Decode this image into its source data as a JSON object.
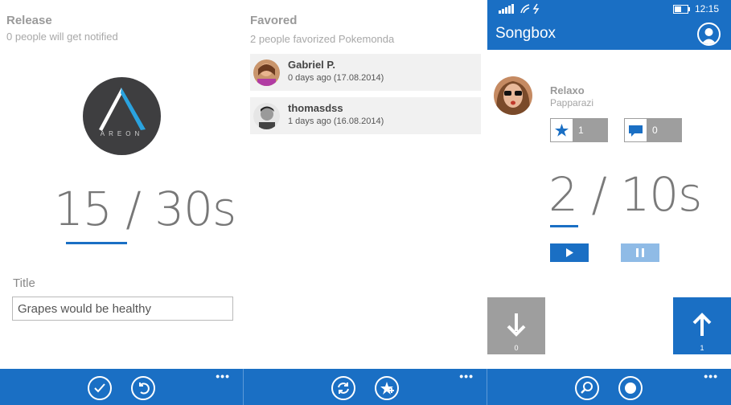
{
  "release": {
    "title": "Release",
    "subtitle": "0 people will get notified",
    "logo_text": "AREON",
    "timer": "15 / 30s",
    "field_label": "Title",
    "field_value": "Grapes would be healthy"
  },
  "favored": {
    "title": "Favored",
    "subtitle": "2 people favorized Pokemonda",
    "users": [
      {
        "name": "Gabriel P.",
        "date": "0 days ago (17.08.2014)"
      },
      {
        "name": "thomasdss",
        "date": "1 days ago (16.08.2014)"
      }
    ]
  },
  "songbox": {
    "clock": "12:15",
    "app_name": "Songbox",
    "song_title": "Relaxo",
    "song_artist": "Papparazi",
    "stars": "1",
    "comments": "0",
    "timer": "2  / 10s",
    "downvotes": "0",
    "upvotes": "1"
  },
  "appbar": {
    "more": "•••"
  },
  "colors": {
    "accent": "#1a6fc4",
    "vote_down": "#9e9e9e",
    "pause_light": "#8fbbe6"
  },
  "icons": [
    "check-icon",
    "undo-icon",
    "refresh-icon",
    "star-add-icon",
    "search-icon",
    "record-icon",
    "star-icon",
    "comment-icon",
    "play-icon",
    "pause-icon",
    "arrow-down-icon",
    "arrow-up-icon",
    "profile-icon",
    "signal-icon",
    "battery-icon"
  ]
}
